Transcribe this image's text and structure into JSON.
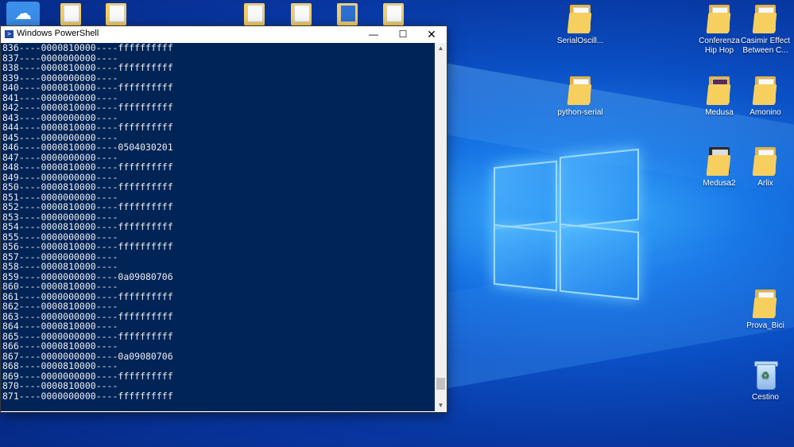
{
  "desktop": {
    "icons": [
      {
        "label": "SerialOscill...",
        "type": "folder"
      },
      {
        "label": "python-serial",
        "type": "folder"
      },
      {
        "label": "Conferenza Hip Hop",
        "type": "folder"
      },
      {
        "label": "Casimir Effect Between C...",
        "type": "folder"
      },
      {
        "label": "Medusa",
        "type": "folder"
      },
      {
        "label": "Amonino",
        "type": "folder"
      },
      {
        "label": "Medusa2",
        "type": "folder-dark"
      },
      {
        "label": "Arlix",
        "type": "folder"
      },
      {
        "label": "Prova_Bici",
        "type": "folder"
      },
      {
        "label": "Cestino",
        "type": "recycle-bin"
      }
    ]
  },
  "window": {
    "title": "Windows PowerShell",
    "controls": {
      "minimize": "—",
      "maximize": "☐",
      "close": "✕"
    },
    "scroll_thumb": {
      "fraction_start": 0.935,
      "fraction_size": 0.035
    },
    "lines": [
      "836----0000810000----ffffffffff",
      "837----0000000000----",
      "838----0000810000----ffffffffff",
      "839----0000000000----",
      "840----0000810000----ffffffffff",
      "841----0000000000----",
      "842----0000810000----ffffffffff",
      "843----0000000000----",
      "844----0000810000----ffffffffff",
      "845----0000000000----",
      "846----0000810000----0504030201",
      "847----0000000000----",
      "848----0000810000----ffffffffff",
      "849----0000000000----",
      "850----0000810000----ffffffffff",
      "851----0000000000----",
      "852----0000810000----ffffffffff",
      "853----0000000000----",
      "854----0000810000----ffffffffff",
      "855----0000000000----",
      "856----0000810000----ffffffffff",
      "857----0000000000----",
      "858----0000810000----",
      "859----0000000000----0a09080706",
      "860----0000810000----",
      "861----0000000000----ffffffffff",
      "862----0000810000----",
      "863----0000000000----ffffffffff",
      "864----0000810000----",
      "865----0000000000----ffffffffff",
      "866----0000810000----",
      "867----0000000000----0a09080706",
      "868----0000810000----",
      "869----0000000000----ffffffffff",
      "870----0000810000----",
      "871----0000000000----ffffffffff"
    ]
  }
}
